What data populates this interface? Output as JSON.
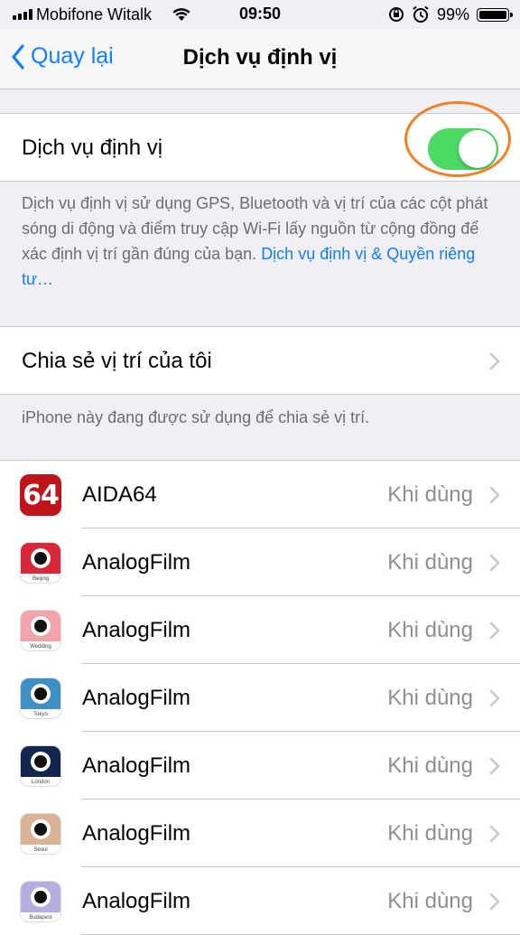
{
  "status": {
    "carrier": "Mobifone Witalk",
    "time": "09:50",
    "battery": "99%"
  },
  "nav": {
    "back_label": "Quay lại",
    "title": "Dịch vụ định vị"
  },
  "location_services": {
    "label": "Dịch vụ định vị",
    "enabled": true,
    "footer_text": "Dịch vụ định vị sử dụng GPS, Bluetooth và vị trí của các cột phát sóng di động và điểm truy cập Wi-Fi lấy nguồn từ cộng đồng để xác định vị trí gần đúng của bạn. ",
    "footer_link": "Dịch vụ định vị & Quyền riêng tư…"
  },
  "share_location": {
    "label": "Chia sẻ vị trí của tôi",
    "footer": "iPhone này đang được sử dụng để chia sẻ vị trí."
  },
  "apps": [
    {
      "name": "AIDA64",
      "value": "Khi dùng",
      "icon": "aida64-icon",
      "icon_text": "64"
    },
    {
      "name": "AnalogFilm",
      "value": "Khi dùng",
      "icon": "analogfilm-icon",
      "city": "Beijing",
      "color": "#d8283a"
    },
    {
      "name": "AnalogFilm",
      "value": "Khi dùng",
      "icon": "analogfilm-icon",
      "city": "Wedding",
      "color": "#f2a3ab"
    },
    {
      "name": "AnalogFilm",
      "value": "Khi dùng",
      "icon": "analogfilm-icon",
      "city": "Tokyo",
      "color": "#3f8fc4"
    },
    {
      "name": "AnalogFilm",
      "value": "Khi dùng",
      "icon": "analogfilm-icon",
      "city": "London",
      "color": "#13264f"
    },
    {
      "name": "AnalogFilm",
      "value": "Khi dùng",
      "icon": "analogfilm-icon",
      "city": "Seoul",
      "color": "#d9b394"
    },
    {
      "name": "AnalogFilm",
      "value": "Khi dùng",
      "icon": "analogfilm-icon",
      "city": "Budapest",
      "color": "#b6aee0"
    }
  ],
  "colors": {
    "accent": "#147efb",
    "switch_on": "#4cd964",
    "highlight": "#f2822a"
  }
}
